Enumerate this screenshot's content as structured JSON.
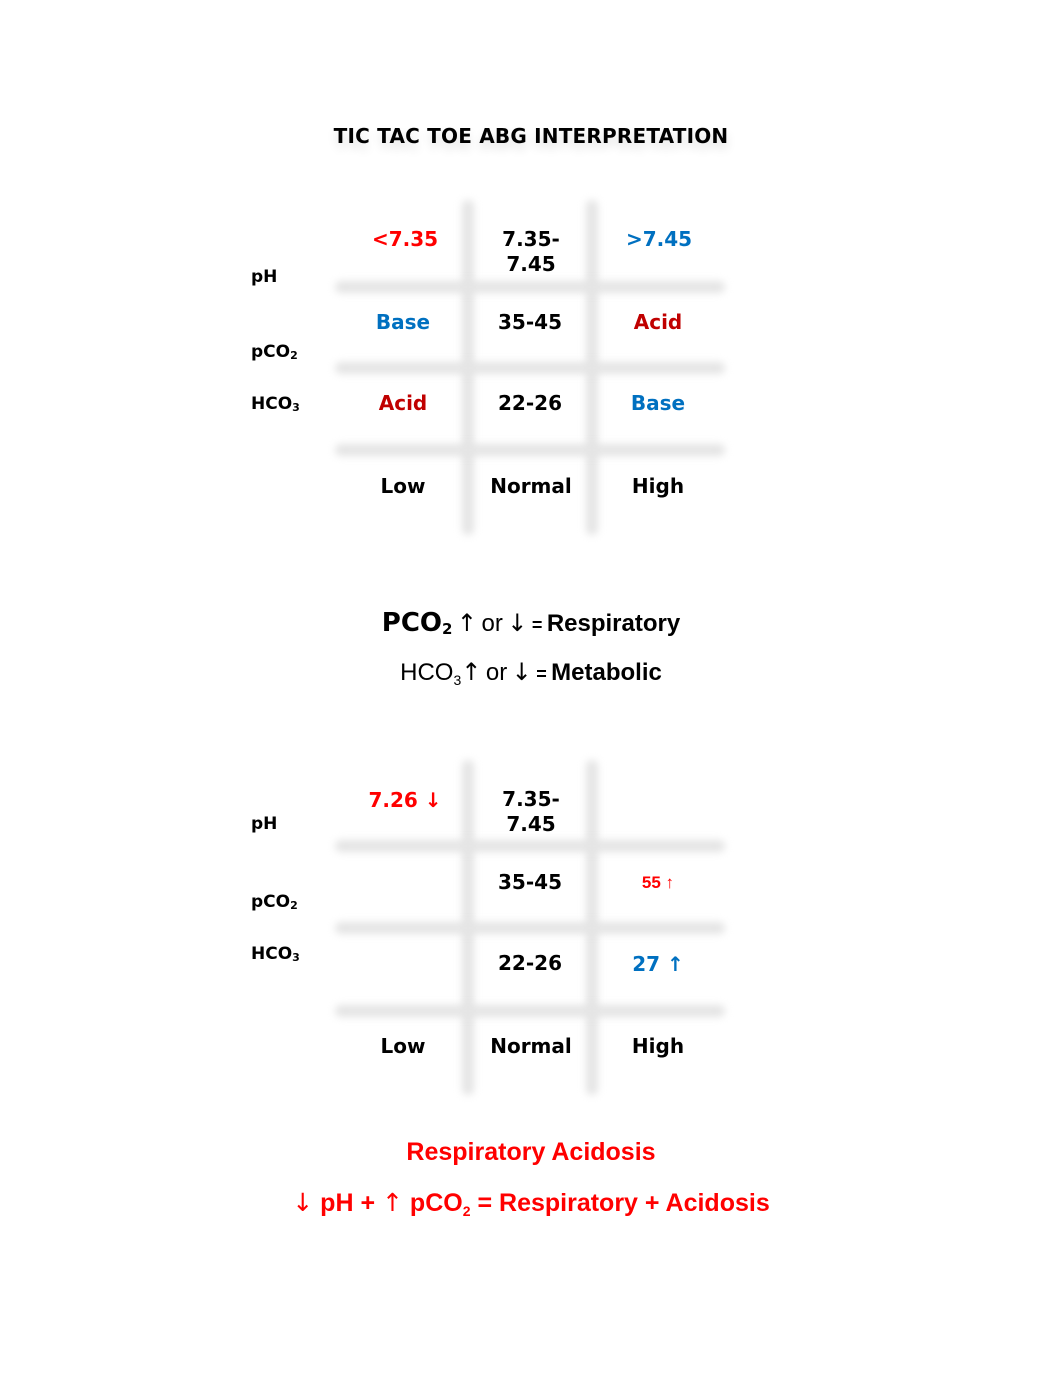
{
  "title": "TIC TAC TOE ABG INTERPRETATION",
  "colors": {
    "low_red": "#ff0000",
    "acid_red": "#c00000",
    "base_blue": "#0070c0",
    "text": "#000000",
    "grid": "#e4e4e4"
  },
  "grid1": {
    "row_labels": {
      "ph": "pH",
      "pco2_base": "pCO",
      "pco2_sub": "2",
      "hco3_base": "HCO",
      "hco3_sub": "3"
    },
    "ph": {
      "low": "<7.35",
      "normal_line1": "7.35-",
      "normal_line2": "7.45",
      "high": ">7.45"
    },
    "pco2": {
      "low": "Base",
      "normal": "35-45",
      "high": "Acid"
    },
    "hco3": {
      "low": "Acid",
      "normal": "22-26",
      "high": "Base"
    },
    "columns": {
      "low": "Low",
      "normal": "Normal",
      "high": "High"
    }
  },
  "rules": {
    "respiratory": {
      "param_base": "PCO",
      "param_sub": "2",
      "up_arrow": "↑",
      "or": "or",
      "down_arrow": "↓",
      "equals": "=",
      "result": "Respiratory"
    },
    "metabolic": {
      "param_base": "HCO",
      "param_sub": "3",
      "up_arrow": "↑",
      "or": "or",
      "down_arrow": "↓",
      "equals": "=",
      "result": "Metabolic"
    }
  },
  "grid2": {
    "row_labels": {
      "ph": "pH",
      "pco2_base": "pCO",
      "pco2_sub": "2",
      "hco3_base": "HCO",
      "hco3_sub": "3"
    },
    "ph": {
      "low": "7.26 ↓",
      "normal_line1": "7.35-",
      "normal_line2": "7.45",
      "high": ""
    },
    "pco2": {
      "low": "",
      "normal": "35-45",
      "high": "55 ↑"
    },
    "hco3": {
      "low": "",
      "normal": "22-26",
      "high": "27 ↑"
    },
    "columns": {
      "low": "Low",
      "normal": "Normal",
      "high": "High"
    }
  },
  "conclusion": {
    "heading": "Respiratory Acidosis",
    "down_arrow": "↓",
    "ph": "pH",
    "plus1": "+",
    "up_arrow": "↑",
    "pco2_base": "pCO",
    "pco2_sub": "2",
    "equals": "=",
    "result": "Respiratory + Acidosis"
  }
}
